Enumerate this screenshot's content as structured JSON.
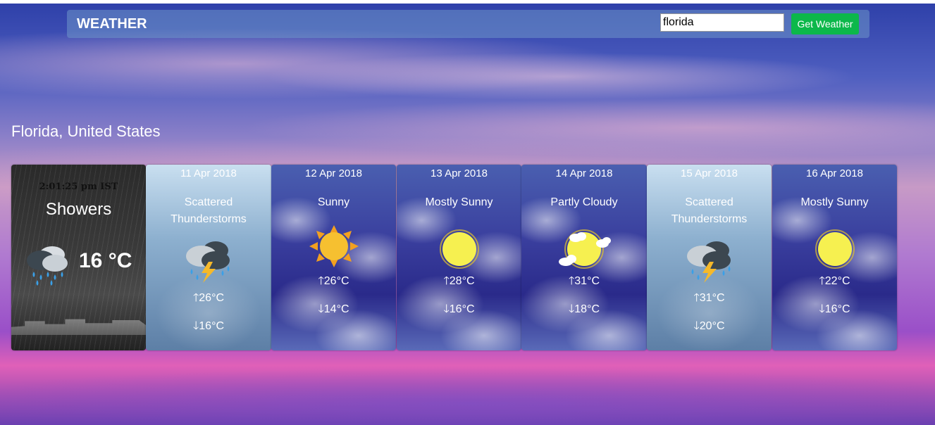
{
  "header": {
    "brand": "WEATHER",
    "search_value": "florida",
    "button_label": "Get Weather"
  },
  "location": "Florida, United States",
  "current": {
    "time": "2:01:25 pm IST",
    "condition": "Showers",
    "temp": "16 °C",
    "icon": "showers-icon"
  },
  "forecast": [
    {
      "date": "11 Apr 2018",
      "condition": "Scattered Thunderstorms",
      "high": "26°C",
      "low": "16°C",
      "icon": "thunderstorm-icon"
    },
    {
      "date": "12 Apr 2018",
      "condition": "Sunny",
      "high": "26°C",
      "low": "14°C",
      "icon": "sun-icon"
    },
    {
      "date": "13 Apr 2018",
      "condition": "Mostly Sunny",
      "high": "28°C",
      "low": "16°C",
      "icon": "mostly-sunny-icon"
    },
    {
      "date": "14 Apr 2018",
      "condition": "Partly Cloudy",
      "high": "31°C",
      "low": "18°C",
      "icon": "partly-cloudy-icon"
    },
    {
      "date": "15 Apr 2018",
      "condition": "Scattered Thunderstorms",
      "high": "31°C",
      "low": "20°C",
      "icon": "thunderstorm-icon"
    },
    {
      "date": "16 Apr 2018",
      "condition": "Mostly Sunny",
      "high": "22°C",
      "low": "16°C",
      "icon": "mostly-sunny-icon"
    }
  ],
  "colors": {
    "button": "#0cb84a",
    "sun": "#f6f050"
  }
}
